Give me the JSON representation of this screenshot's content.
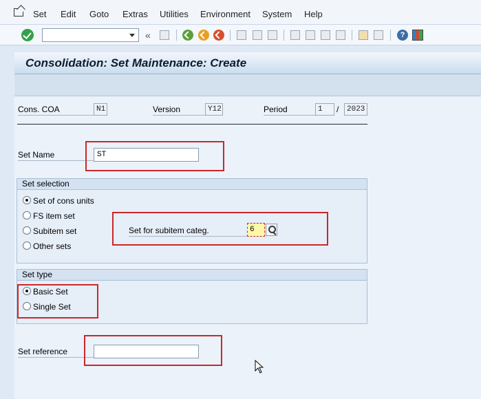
{
  "menu": {
    "items": [
      "Set",
      "Edit",
      "Goto",
      "Extras",
      "Utilities",
      "Environment",
      "System",
      "Help"
    ]
  },
  "toolbar": {
    "command_field_value": "",
    "icons": [
      "enter-icon",
      "command-dropdown",
      "collapse-icon",
      "save-icon",
      "back-icon",
      "exit-icon",
      "cancel-icon",
      "print-icon",
      "find-icon",
      "find-next-icon",
      "first-page-icon",
      "previous-page-icon",
      "next-page-icon",
      "last-page-icon",
      "create-session-icon",
      "shortcut-icon",
      "help-icon",
      "layout-icon"
    ]
  },
  "title": "Consolidation: Set Maintenance: Create",
  "header_fields": {
    "cons_coa_label": "Cons. COA",
    "cons_coa_value": "N1",
    "version_label": "Version",
    "version_value": "Y12",
    "period_label": "Period",
    "period_value": "1",
    "period_separator": "/",
    "year_value": "2023"
  },
  "set_name": {
    "label": "Set Name",
    "value": "ST"
  },
  "set_selection": {
    "title": "Set selection",
    "options": [
      "Set of cons units",
      "FS item set",
      "Subitem set",
      "Other sets"
    ],
    "selected_index": 0,
    "subitem_categ_label": "Set for subitem categ.",
    "subitem_categ_value": "6"
  },
  "set_type": {
    "title": "Set type",
    "options": [
      "Basic Set",
      "Single Set"
    ],
    "selected_index": 0
  },
  "set_reference": {
    "label": "Set reference",
    "value": ""
  },
  "colors": {
    "highlight_box": "#c9272a",
    "background": "#ebf2fa",
    "title_text": "#0d1e33"
  }
}
